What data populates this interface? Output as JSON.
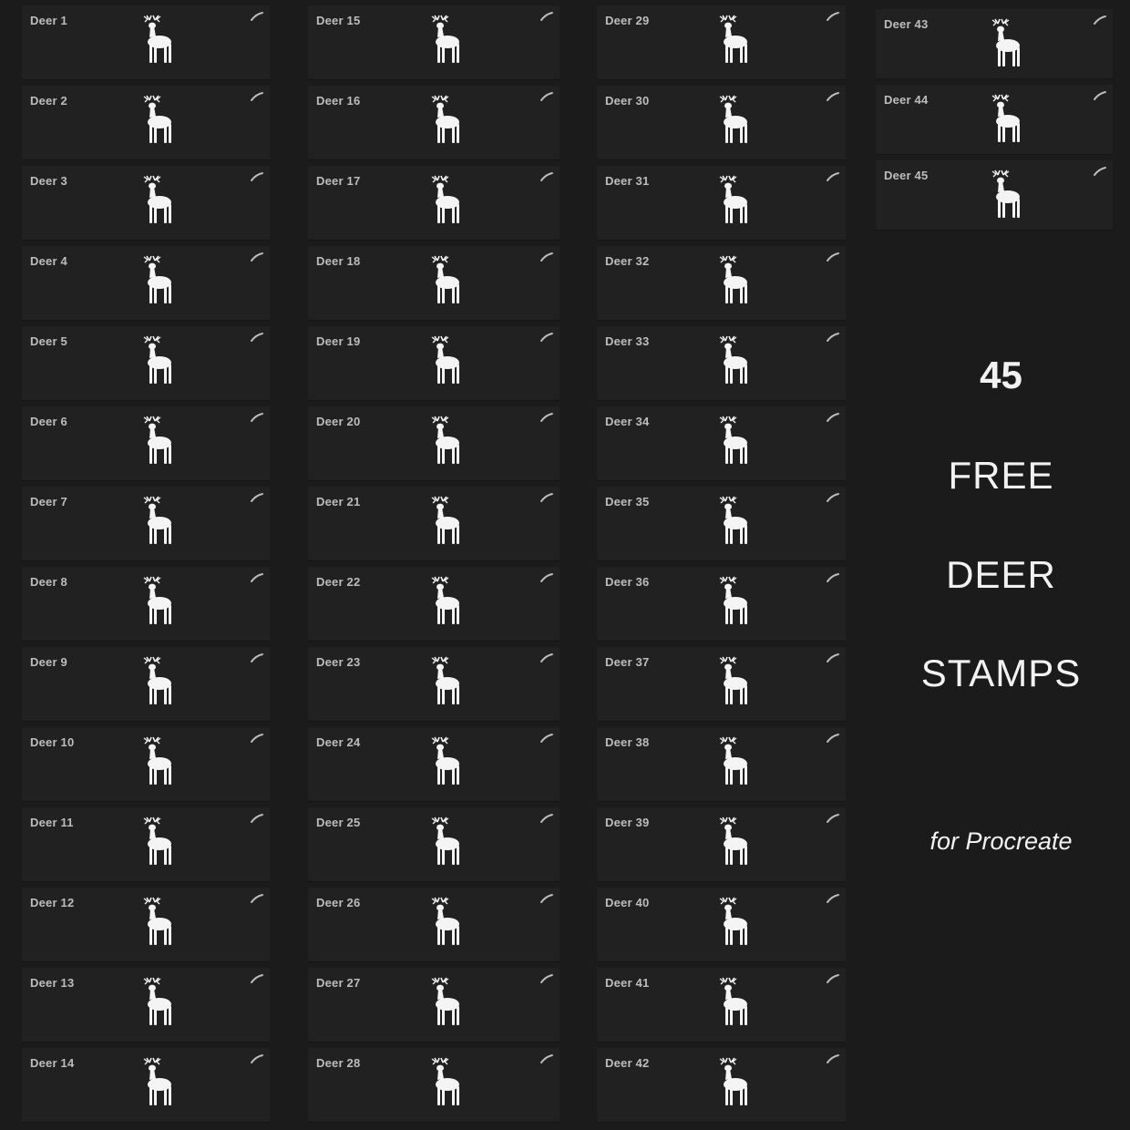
{
  "colors": {
    "background": "#1b1b1c",
    "card": "#212122",
    "label": "#bdbdbd",
    "stamp": "#f4f4f4",
    "promo_text": "#f2f2f2"
  },
  "icons": {
    "brush_indicator": "brush-stroke-icon",
    "stamp_preview": "deer-silhouette-icon"
  },
  "brush_columns": [
    {
      "brushes": [
        "Deer 1",
        "Deer 2",
        "Deer 3",
        "Deer 4",
        "Deer 5",
        "Deer 6",
        "Deer 7",
        "Deer 8",
        "Deer 9",
        "Deer 10",
        "Deer 11",
        "Deer 12",
        "Deer 13",
        "Deer 14"
      ]
    },
    {
      "brushes": [
        "Deer 15",
        "Deer 16",
        "Deer 17",
        "Deer 18",
        "Deer 19",
        "Deer 20",
        "Deer 21",
        "Deer 22",
        "Deer 23",
        "Deer 24",
        "Deer 25",
        "Deer 26",
        "Deer 27",
        "Deer 28"
      ]
    },
    {
      "brushes": [
        "Deer 29",
        "Deer 30",
        "Deer 31",
        "Deer 32",
        "Deer 33",
        "Deer 34",
        "Deer 35",
        "Deer 36",
        "Deer 37",
        "Deer 38",
        "Deer 39",
        "Deer 40",
        "Deer 41",
        "Deer 42"
      ]
    },
    {
      "brushes": [
        "Deer 43",
        "Deer 44",
        "Deer 45"
      ]
    }
  ],
  "promo": {
    "count": "45",
    "line1": "FREE",
    "line2": "DEER",
    "line3": "STAMPS",
    "subtitle": "for Procreate"
  }
}
